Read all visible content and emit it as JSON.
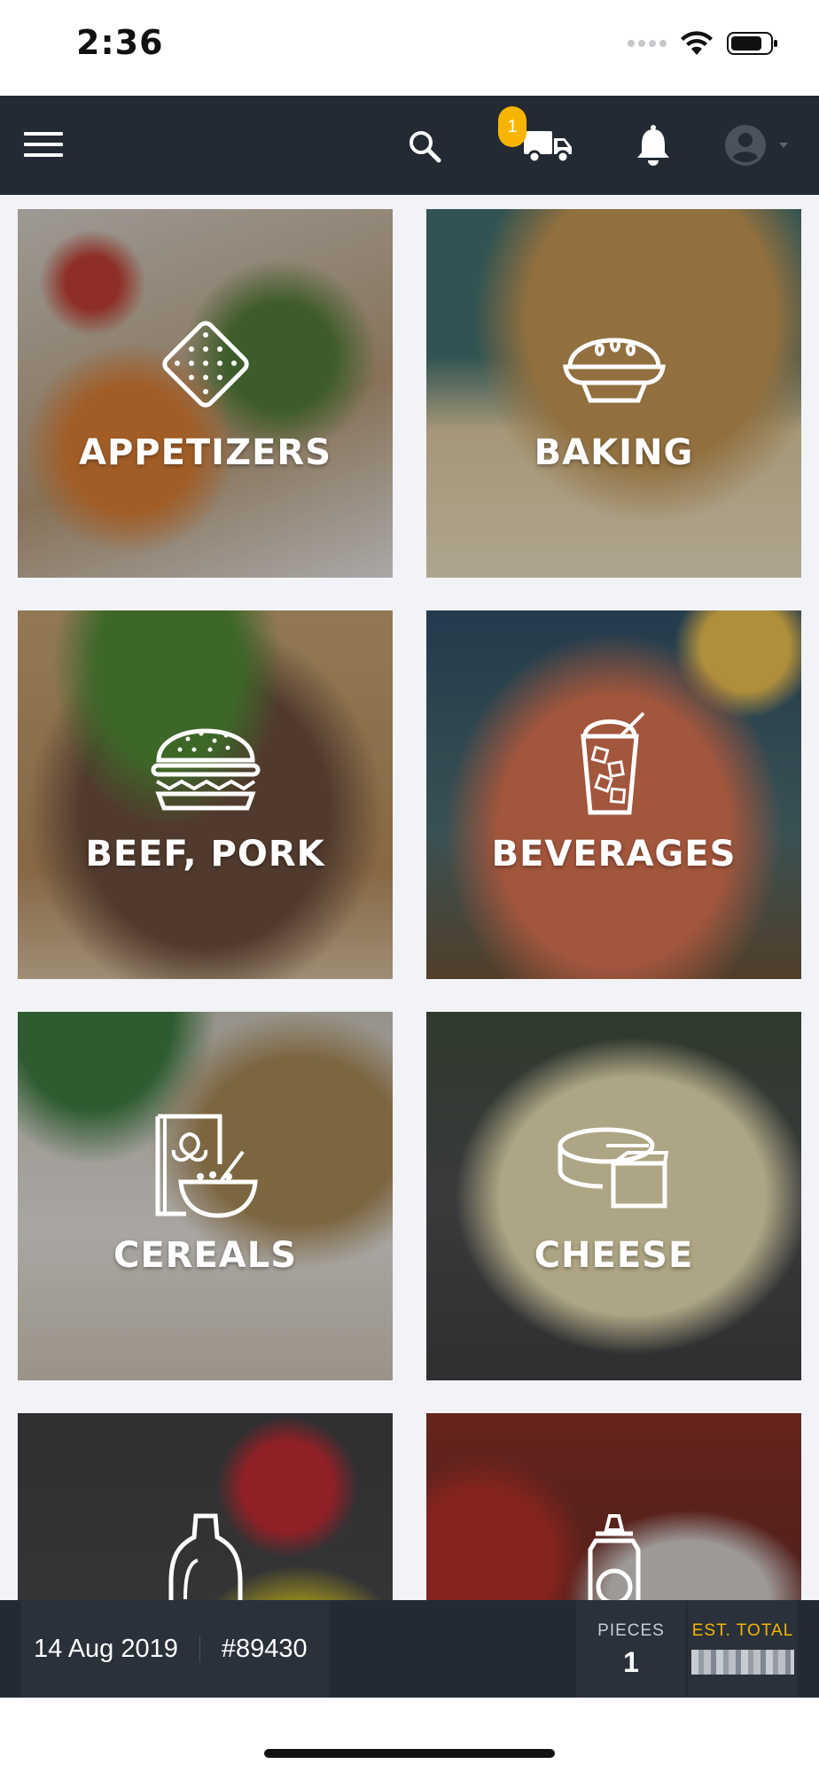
{
  "status_bar": {
    "time": "2:36",
    "icons": [
      "signal-dots-icon",
      "wifi-icon",
      "battery-icon"
    ]
  },
  "nav": {
    "menu_icon": "hamburger-menu-icon",
    "search_icon": "search-icon",
    "cart_icon": "delivery-truck-icon",
    "cart_badge": "1",
    "notification_icon": "bell-icon",
    "account_icon": "user-avatar-icon",
    "colors": {
      "bar": "#232a34",
      "badge": "#f7b500"
    }
  },
  "categories": [
    {
      "label": "APPETIZERS",
      "icon": "cracker-icon"
    },
    {
      "label": "BAKING",
      "icon": "pie-icon"
    },
    {
      "label": "BEEF, PORK",
      "icon": "burger-icon"
    },
    {
      "label": "BEVERAGES",
      "icon": "drink-glass-icon"
    },
    {
      "label": "CEREALS",
      "icon": "cereal-box-icon"
    },
    {
      "label": "CHEESE",
      "icon": "cheese-wheel-icon"
    },
    {
      "label": "",
      "icon": "detergent-bottle-icon"
    },
    {
      "label": "",
      "icon": "sauce-bottle-icon"
    }
  ],
  "order_bar": {
    "date": "14 Aug 2019",
    "order_number": "#89430",
    "pieces_label": "PIECES",
    "pieces_value": "1",
    "total_label": "EST. TOTAL",
    "colors": {
      "total_label": "#f7b500"
    }
  }
}
